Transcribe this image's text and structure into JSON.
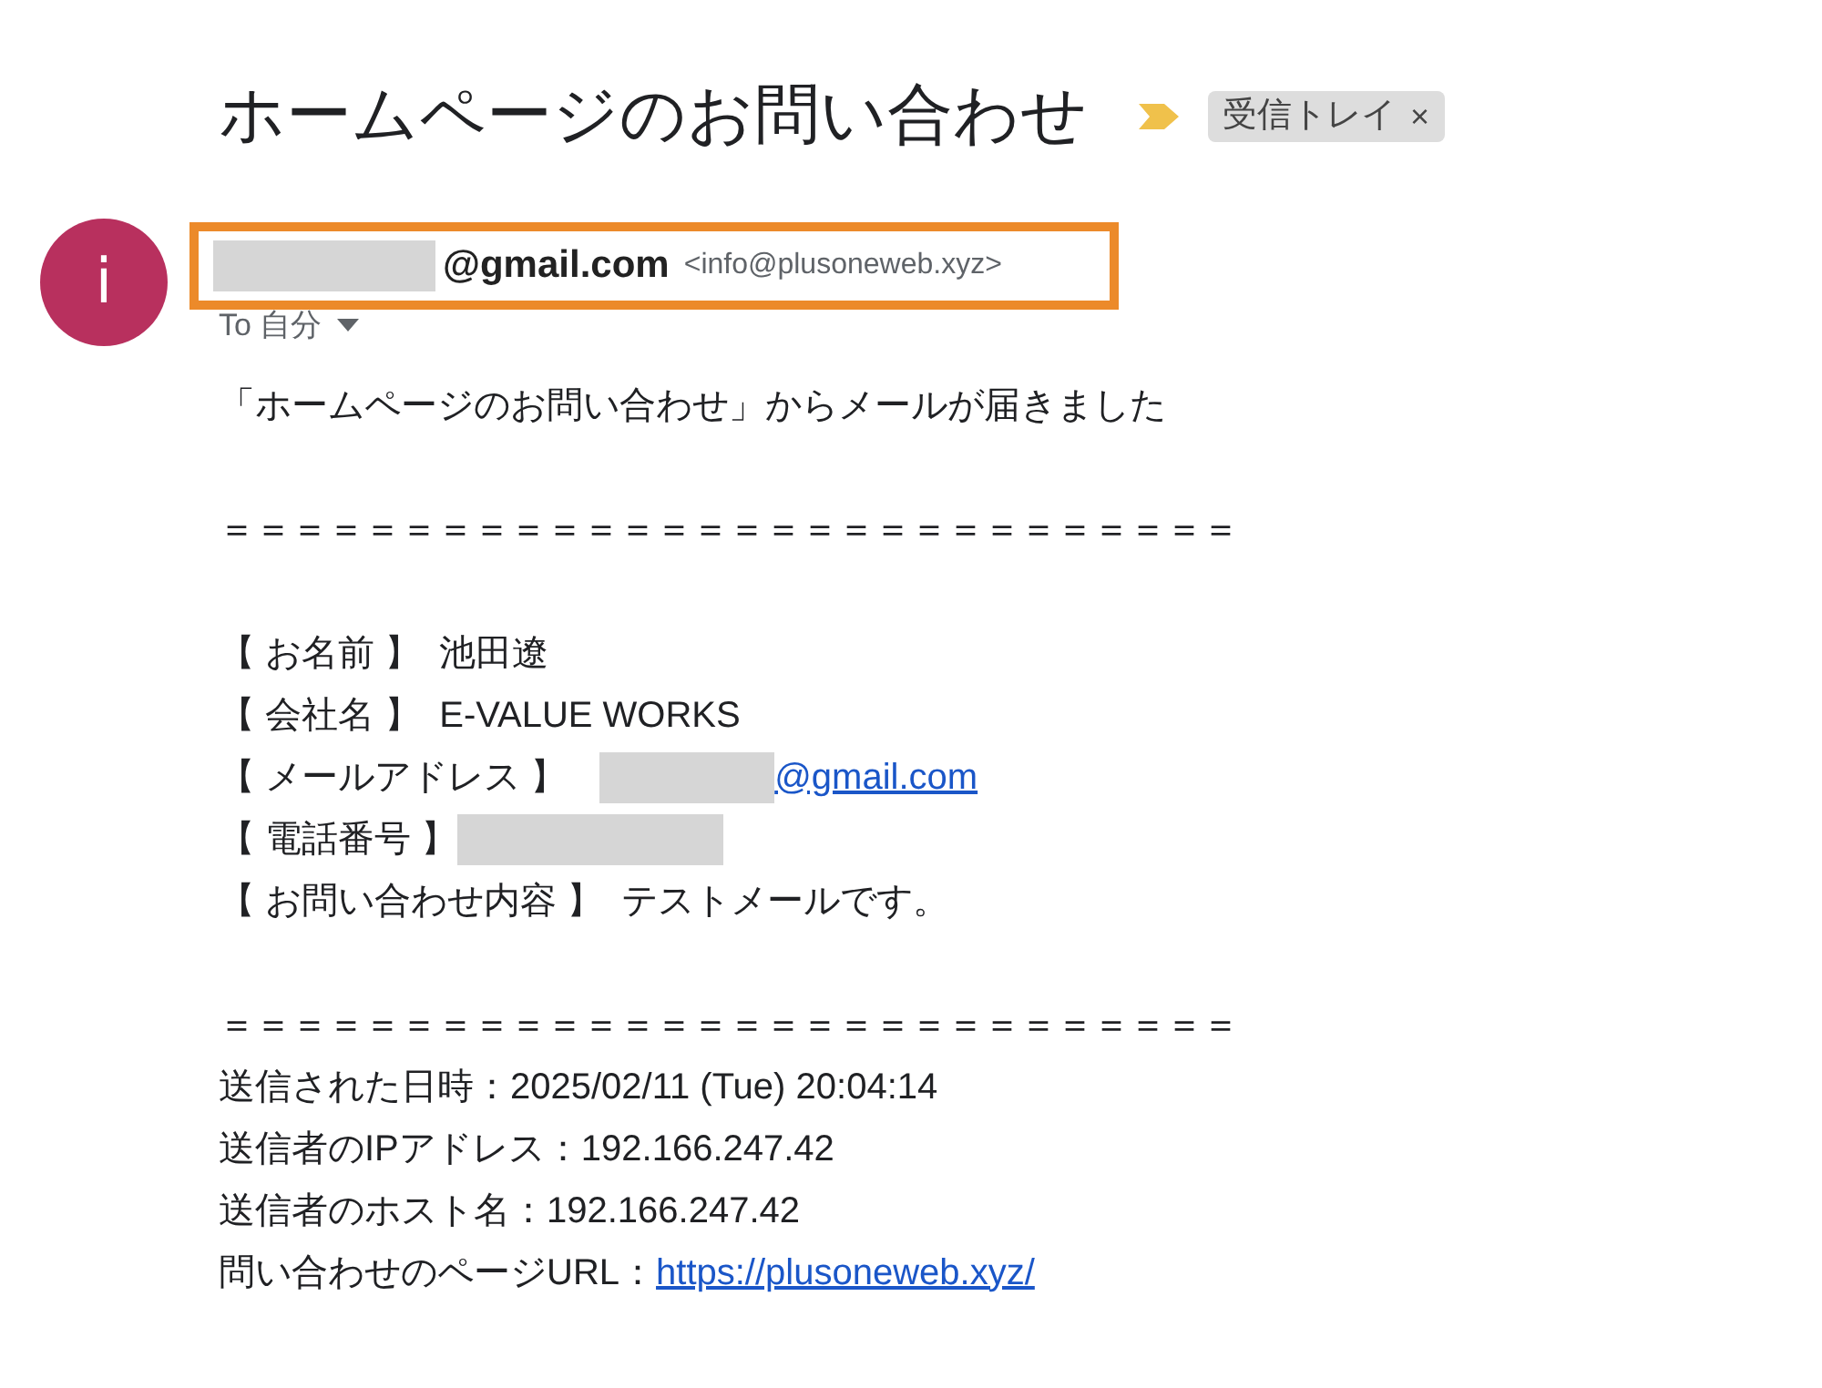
{
  "subject": "ホームページのお問い合わせ",
  "label": {
    "text": "受信トレイ",
    "close": "×"
  },
  "sender": {
    "avatar_letter": "i",
    "name_redacted": true,
    "name_suffix": "@gmail.com",
    "address": "<info@plusoneweb.xyz>",
    "highlighted": true
  },
  "recipient": {
    "text": "To 自分"
  },
  "paragraphs": [
    {
      "lines": [
        {
          "kind": "text",
          "text": "「ホームページのお問い合わせ」からメールが届きました"
        }
      ]
    },
    {
      "lines": [
        {
          "kind": "text",
          "text": "＝＝＝＝＝＝＝＝＝＝＝＝＝＝＝＝＝＝＝＝＝＝＝＝＝＝＝＝"
        }
      ]
    },
    {
      "lines": [
        {
          "kind": "field",
          "label": "【 お名前 】",
          "value": "池田遼"
        },
        {
          "kind": "field",
          "label": "【 会社名 】",
          "value": "E-VALUE WORKS"
        },
        {
          "kind": "link",
          "label": "【 メールアドレス 】",
          "redacted": true,
          "link": "@gmail.com"
        },
        {
          "kind": "field",
          "label": "【 電話番号 】",
          "redacted": true
        },
        {
          "kind": "field",
          "label": "【 お問い合わせ内容 】",
          "value": "テストメールです。"
        }
      ]
    },
    {
      "lines": [
        {
          "kind": "text",
          "text": "＝＝＝＝＝＝＝＝＝＝＝＝＝＝＝＝＝＝＝＝＝＝＝＝＝＝＝＝"
        },
        {
          "kind": "text",
          "text": "送信された日時：2025/02/11 (Tue) 20:04:14"
        },
        {
          "kind": "text",
          "text": "送信者のIPアドレス：192.166.247.42"
        },
        {
          "kind": "text",
          "text": "送信者のホスト名：192.166.247.42"
        },
        {
          "kind": "link",
          "label": "問い合わせのページURL：",
          "link": "https://plusoneweb.xyz/"
        }
      ]
    }
  ]
}
